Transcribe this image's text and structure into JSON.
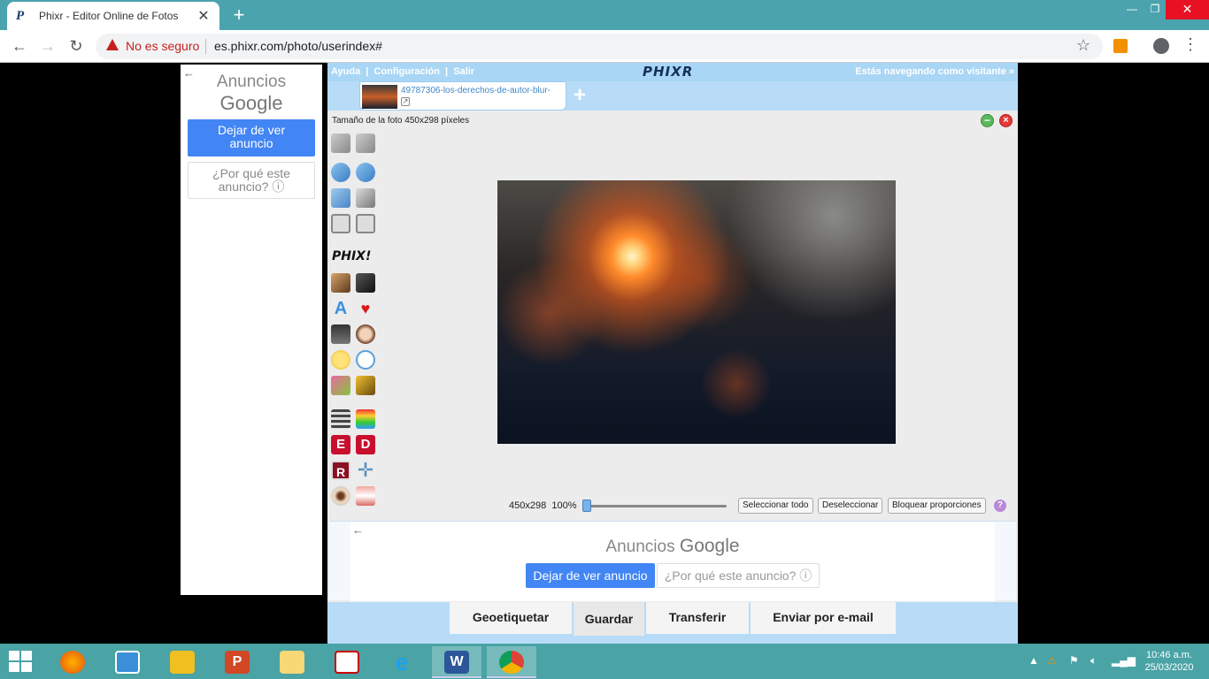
{
  "browser": {
    "tab_title": "Phixr - Editor Online de Fotos",
    "tab_favicon": "P",
    "new_tab": "+",
    "security_label": "No es seguro",
    "url": "es.phixr.com/photo/userindex#"
  },
  "left_ad": {
    "back": "←",
    "title": "Anuncios",
    "brand": "Google",
    "stop_button": "Dejar de ver anuncio",
    "why_button": "¿Por qué este anuncio? ⓘ"
  },
  "app": {
    "links": [
      "Ayuda",
      "Configuración",
      "Salir"
    ],
    "link_sep": "|",
    "logo": "PHIXR",
    "visitor": "Estás navegando como visitante »",
    "photo_tab_name": "49787306-los-derechos-de-autor-blur-",
    "add_tab": "+",
    "size_info": "Tamaño de la foto 450x298 píxeles",
    "phix_label": "PHIX!",
    "dimensions": "450x298",
    "zoom": "100%",
    "select_all": "Seleccionar todo",
    "deselect": "Deseleccionar",
    "lock_ratio": "Bloquear proporciones",
    "help": "?"
  },
  "bottom_ad": {
    "back": "←",
    "title": "Anuncios",
    "brand": "Google",
    "stop_button": "Dejar de ver anuncio",
    "why_button": "¿Por qué este anuncio? ⓘ"
  },
  "bottom_tabs": [
    "Geoetiquetar",
    "Guardar",
    "Transferir",
    "Enviar por e-mail"
  ],
  "taskbar": {
    "time": "10:46 a.m.",
    "date": "25/03/2020"
  }
}
